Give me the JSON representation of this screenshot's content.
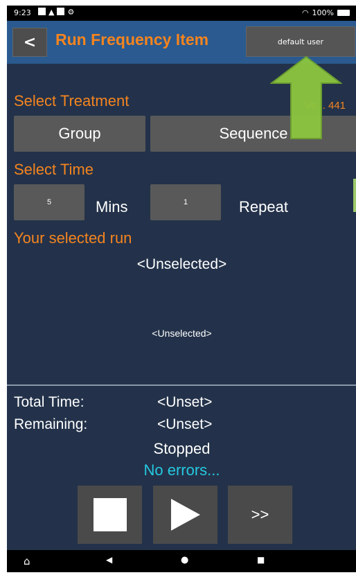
{
  "status_bar": {
    "time": "9:23",
    "battery": "100%"
  },
  "header": {
    "back_label": "<",
    "title": "Run Frequency Item",
    "user_label": "default user"
  },
  "treatment": {
    "label": "Select Treatment",
    "version": "Ve... 441",
    "group_label": "Group",
    "sequence_label": "Sequence"
  },
  "time": {
    "label": "Select Time",
    "mins_value": "5",
    "mins_label": "Mins",
    "repeat_value": "1",
    "repeat_label": "Repeat"
  },
  "selected_run": {
    "label": "Your selected run",
    "primary": "<Unselected>",
    "secondary": "<Unselected>"
  },
  "summary": {
    "total_label": "Total Time:",
    "total_value": "<Unset>",
    "remaining_label": "Remaining:",
    "remaining_value": "<Unset>",
    "state": "Stopped",
    "errors": "No errors..."
  },
  "controls": {
    "stop_icon": "stop-icon",
    "play_icon": "play-icon",
    "skip_label": ">>"
  },
  "colors": {
    "accent": "#f5841f",
    "background": "#23324a",
    "header": "#2a5a8f",
    "button": "#595959",
    "error_text": "#25c9e0",
    "arrow": "#8dc63f"
  }
}
